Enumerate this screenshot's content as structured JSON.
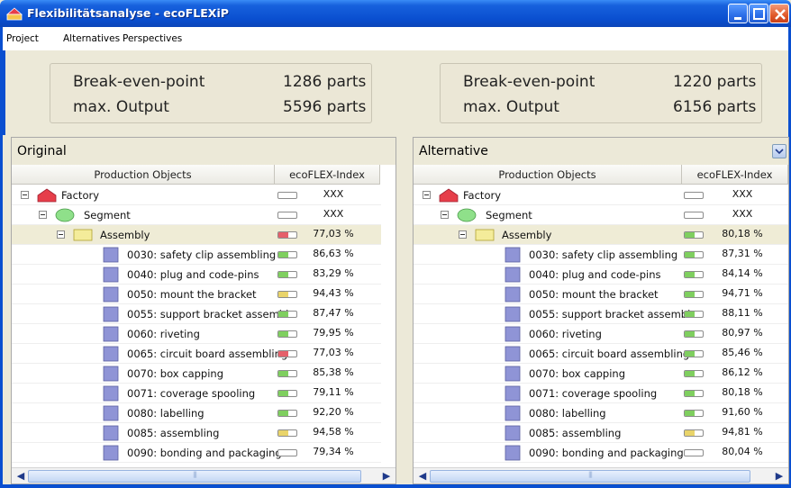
{
  "window": {
    "title": "Flexibilitätsanalyse - ecoFLEXiP"
  },
  "menu": [
    "Project",
    "Alternatives",
    "Perspectives"
  ],
  "summary": {
    "left": {
      "break_even_label": "Break-even-point",
      "break_even_value": "1286 parts",
      "max_output_label": "max. Output",
      "max_output_value": "5596 parts"
    },
    "right": {
      "break_even_label": "Break-even-point",
      "break_even_value": "1220 parts",
      "max_output_label": "max. Output",
      "max_output_value": "6156 parts"
    }
  },
  "colors": {
    "titlebar": "#0a4fd0",
    "gauge_green": "#7fcf5f",
    "gauge_red": "#e5606a",
    "gauge_yellow": "#e9d46a",
    "factory": "#e63e4a",
    "segment": "#8fe08a",
    "assembly": "#f4ec9a",
    "station": "#8f94d6"
  },
  "panels": [
    {
      "header": "Original",
      "columns": [
        "Production Objects",
        "ecoFLEX-Index"
      ],
      "rows": [
        {
          "level": 0,
          "icon": "factory-icon",
          "name": "Factory",
          "value": "XXX",
          "gauge": "empty"
        },
        {
          "level": 1,
          "icon": "segment-icon",
          "name": "Segment",
          "value": "XXX",
          "gauge": "empty"
        },
        {
          "level": 2,
          "icon": "assembly-icon",
          "name": "Assembly",
          "value": "77,03 %",
          "gauge": "red",
          "highlight": true
        },
        {
          "level": 3,
          "icon": "station-icon",
          "name": "0030: safety clip assembling",
          "value": "86,63 %",
          "gauge": "green"
        },
        {
          "level": 3,
          "icon": "station-icon",
          "name": "0040: plug and code-pins",
          "value": "83,29 %",
          "gauge": "green"
        },
        {
          "level": 3,
          "icon": "station-icon",
          "name": "0050: mount the bracket",
          "value": "94,43 %",
          "gauge": "yellow"
        },
        {
          "level": 3,
          "icon": "station-icon",
          "name": "0055: support bracket assembl.",
          "value": "87,47 %",
          "gauge": "green"
        },
        {
          "level": 3,
          "icon": "station-icon",
          "name": "0060: riveting",
          "value": "79,95 %",
          "gauge": "green"
        },
        {
          "level": 3,
          "icon": "station-icon",
          "name": "0065: circuit board assembling",
          "value": "77,03 %",
          "gauge": "red"
        },
        {
          "level": 3,
          "icon": "station-icon",
          "name": "0070: box capping",
          "value": "85,38 %",
          "gauge": "green"
        },
        {
          "level": 3,
          "icon": "station-icon",
          "name": "0071: coverage spooling",
          "value": "79,11 %",
          "gauge": "green"
        },
        {
          "level": 3,
          "icon": "station-icon",
          "name": "0080: labelling",
          "value": "92,20 %",
          "gauge": "green"
        },
        {
          "level": 3,
          "icon": "station-icon",
          "name": "0085: assembling",
          "value": "94,58 %",
          "gauge": "yellow"
        },
        {
          "level": 3,
          "icon": "station-icon",
          "name": "0090: bonding and  packaging",
          "value": "79,34 %",
          "gauge": "empty"
        }
      ]
    },
    {
      "header": "Alternative",
      "columns": [
        "Production Objects",
        "ecoFLEX-Index"
      ],
      "rows": [
        {
          "level": 0,
          "icon": "factory-icon",
          "name": "Factory",
          "value": "XXX",
          "gauge": "empty"
        },
        {
          "level": 1,
          "icon": "segment-icon",
          "name": "Segment",
          "value": "XXX",
          "gauge": "empty"
        },
        {
          "level": 2,
          "icon": "assembly-icon",
          "name": "Assembly",
          "value": "80,18 %",
          "gauge": "green",
          "highlight": true
        },
        {
          "level": 3,
          "icon": "station-icon",
          "name": "0030: safety clip assembling",
          "value": "87,31 %",
          "gauge": "green"
        },
        {
          "level": 3,
          "icon": "station-icon",
          "name": "0040: plug and code-pins",
          "value": "84,14 %",
          "gauge": "green"
        },
        {
          "level": 3,
          "icon": "station-icon",
          "name": "0050: mount the bracket",
          "value": "94,71 %",
          "gauge": "green"
        },
        {
          "level": 3,
          "icon": "station-icon",
          "name": "0055: support bracket assembl.",
          "value": "88,11 %",
          "gauge": "green"
        },
        {
          "level": 3,
          "icon": "station-icon",
          "name": "0060: riveting",
          "value": "80,97 %",
          "gauge": "green"
        },
        {
          "level": 3,
          "icon": "station-icon",
          "name": "0065: circuit board assembling",
          "value": "85,46 %",
          "gauge": "green"
        },
        {
          "level": 3,
          "icon": "station-icon",
          "name": "0070: box capping",
          "value": "86,12 %",
          "gauge": "green"
        },
        {
          "level": 3,
          "icon": "station-icon",
          "name": "0071: coverage spooling",
          "value": "80,18 %",
          "gauge": "green"
        },
        {
          "level": 3,
          "icon": "station-icon",
          "name": "0080: labelling",
          "value": "91,60 %",
          "gauge": "green"
        },
        {
          "level": 3,
          "icon": "station-icon",
          "name": "0085: assembling",
          "value": "94,81 %",
          "gauge": "yellow"
        },
        {
          "level": 3,
          "icon": "station-icon",
          "name": "0090: bonding and  packaging",
          "value": "80,04 %",
          "gauge": "empty"
        }
      ]
    }
  ]
}
